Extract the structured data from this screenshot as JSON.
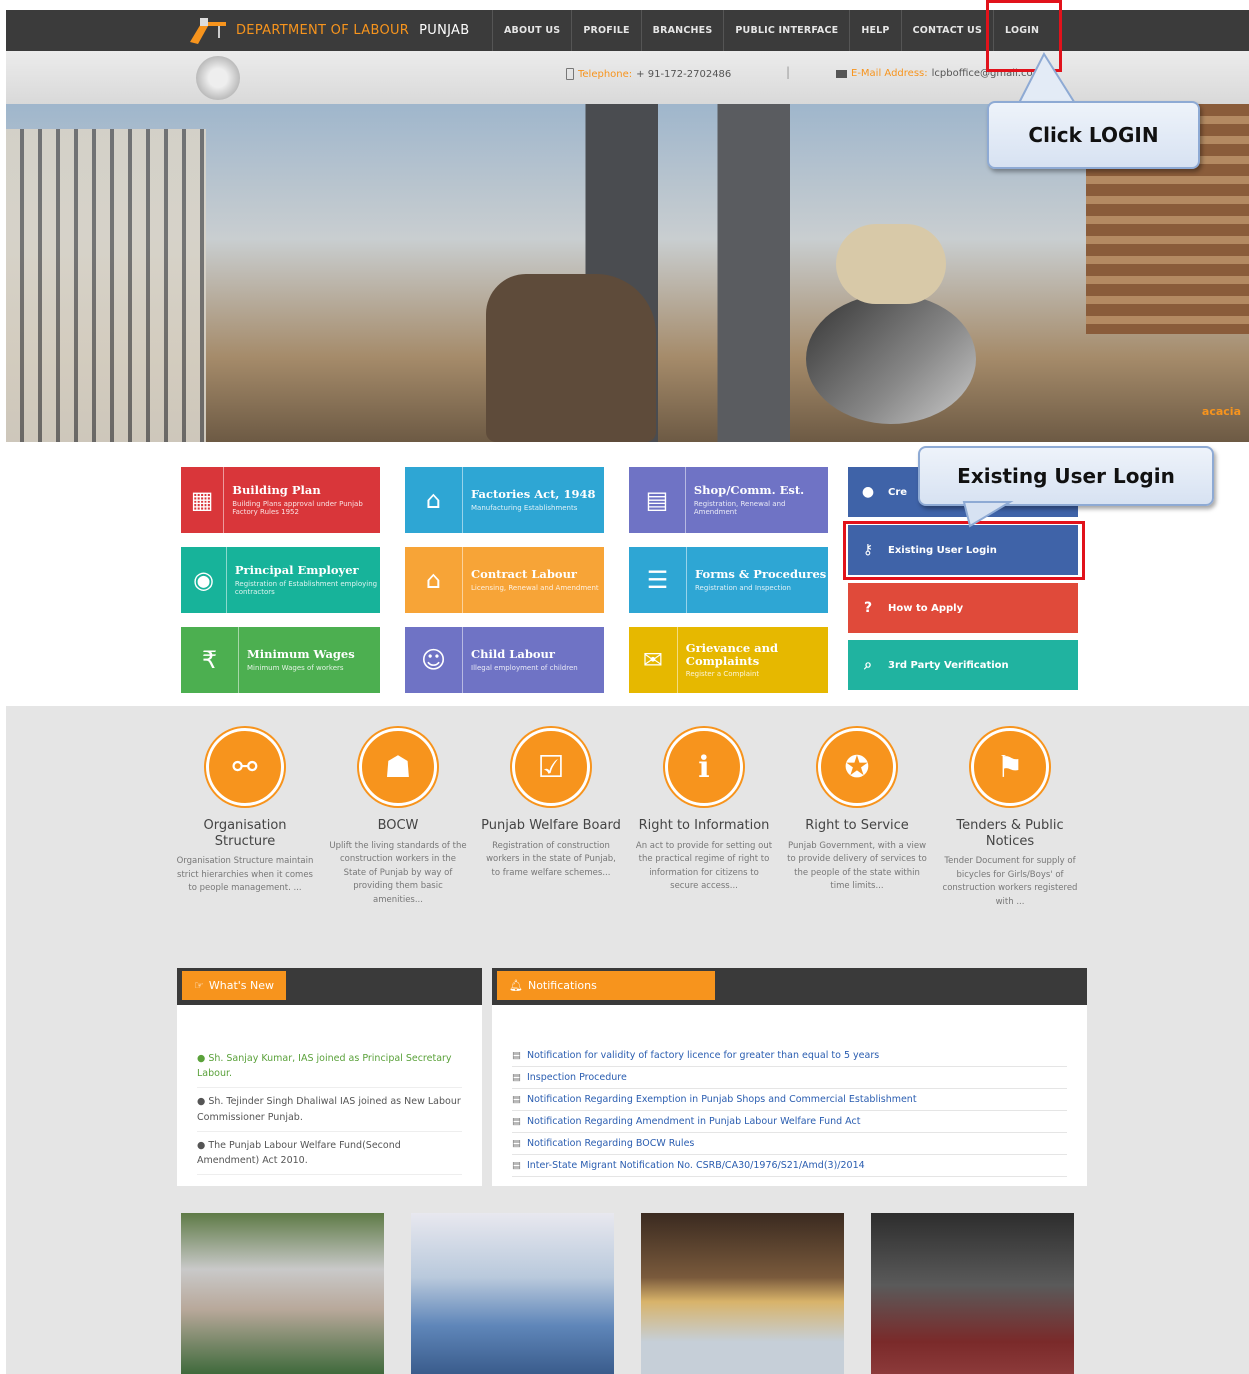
{
  "nav": {
    "brand_orange": "DEPARTMENT OF LABOUR",
    "brand_white": "PUNJAB",
    "items": [
      "ABOUT US",
      "PROFILE",
      "BRANCHES",
      "PUBLIC INTERFACE",
      "HELP",
      "CONTACT US",
      "LOGIN"
    ]
  },
  "infobar": {
    "phone_label": "Telephone:",
    "phone_value": "+ 91-172-2702486",
    "separator": "|",
    "email_label": "E-Mail Address:",
    "email_value": "lcpboffice@gmail.com"
  },
  "hero": {
    "brand": "acacia"
  },
  "tiles": [
    {
      "title": "Building Plan",
      "sub": "Building Plans approval under Punjab Factory Rules 1952",
      "color": "#d9363a",
      "icon": "building-icon"
    },
    {
      "title": "Factories Act, 1948",
      "sub": "Manufacturing Establishments",
      "color": "#2ea6d4",
      "icon": "factory-icon"
    },
    {
      "title": "Shop/Comm. Est.",
      "sub": "Registration, Renewal and Amendment",
      "color": "#6f73c5",
      "icon": "shop-icon"
    },
    {
      "title": "Principal Employer",
      "sub": "Registration of Establishment employing contractors",
      "color": "#17b39a",
      "icon": "employer-icon"
    },
    {
      "title": "Contract Labour",
      "sub": "Licensing, Renewal and Amendment",
      "color": "#f7a437",
      "icon": "labour-icon"
    },
    {
      "title": "Forms & Procedures",
      "sub": "Registration and Inspection",
      "color": "#2ea6d4",
      "icon": "forms-icon"
    },
    {
      "title": "Minimum Wages",
      "sub": "Minimum Wages of workers",
      "color": "#4caf50",
      "icon": "wages-icon"
    },
    {
      "title": "Child Labour",
      "sub": "Illegal employment of children",
      "color": "#6f73c5",
      "icon": "child-icon"
    },
    {
      "title": "Grievance and Complaints",
      "sub": "Register a Complaint",
      "color": "#e6b800",
      "icon": "grievance-icon"
    }
  ],
  "side_tiles": [
    {
      "label": "Cre",
      "color": "#3f63a8",
      "icon": "user-icon"
    },
    {
      "label": "Existing User Login",
      "color": "#3f63a8",
      "icon": "key-icon"
    },
    {
      "label": "How to Apply",
      "color": "#e04a3a",
      "icon": "question-icon"
    },
    {
      "label": "3rd Party Verification",
      "color": "#20b3a0",
      "icon": "search-icon"
    }
  ],
  "features": [
    {
      "title": "Organisation Structure",
      "desc": "Organisation Structure maintain strict hierarchies when it comes to people management. ..."
    },
    {
      "title": "BOCW",
      "desc": "Uplift the living standards of the construction workers in the State of Punjab by way of providing them basic amenities..."
    },
    {
      "title": "Punjab Welfare Board",
      "desc": "Registration of construction workers in the state of Punjab, to frame welfare schemes..."
    },
    {
      "title": "Right to Information",
      "desc": "An act to provide for setting out the practical regime of right to information for citizens to secure access..."
    },
    {
      "title": "Right to Service",
      "desc": "Punjab Government, with a view to provide delivery of services to the people of the state within time limits..."
    },
    {
      "title": "Tenders & Public Notices",
      "desc": "Tender Document for supply of bicycles for Girls/Boys' of construction workers registered with ..."
    }
  ],
  "whats_new": {
    "tab": "What's New",
    "items": [
      "Sh. Sanjay Kumar, IAS joined as Principal Secretary Labour.",
      "Sh. Tejinder Singh Dhaliwal IAS joined as New Labour Commissioner Punjab.",
      "The Punjab Labour Welfare Fund(Second Amendment) Act 2010."
    ]
  },
  "notifications": {
    "tab": "Notifications",
    "items": [
      "Notification for validity of factory licence for greater than equal to 5 years",
      "Inspection Procedure",
      "Notification Regarding Exemption in Punjab Shops and Commercial Establishment",
      "Notification Regarding Amendment in Punjab Labour Welfare Fund Act",
      "Notification Regarding BOCW Rules",
      "Inter-State Migrant Notification No. CSRB/CA30/1976/S21/Amd(3)/2014"
    ]
  },
  "callouts": {
    "login": "Click LOGIN",
    "existing": "Existing User Login"
  }
}
